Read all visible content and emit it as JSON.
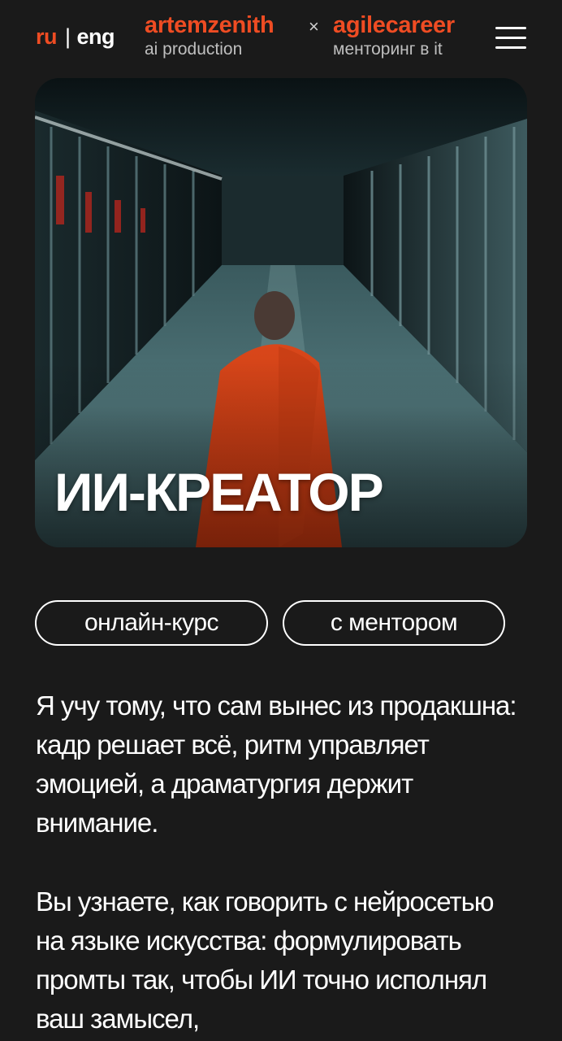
{
  "header": {
    "lang_ru": "ru",
    "lang_sep": "|",
    "lang_eng": "eng",
    "brand_a_name": "artemzenith",
    "brand_a_sub": "ai production",
    "times": "×",
    "brand_b_name": "agilecareer",
    "brand_b_sub": "менторинг в it"
  },
  "hero": {
    "title": "ИИ-КРЕАТОР"
  },
  "tags": [
    "онлайн-курс",
    "с ментором"
  ],
  "paragraphs": [
    "Я учу тому, что сам вынес из продакшна: кадр решает всё, ритм управляет эмоцией, а драматургия держит внимание.",
    "Вы узнаете, как говорить с нейросетью на языке искусства: формулировать промты так, чтобы ИИ точно исполнял ваш замысел,"
  ],
  "colors": {
    "accent": "#ef4c23",
    "background": "#1a1a1a",
    "text": "#ffffff"
  },
  "icons": {
    "menu": "hamburger-menu-icon"
  }
}
